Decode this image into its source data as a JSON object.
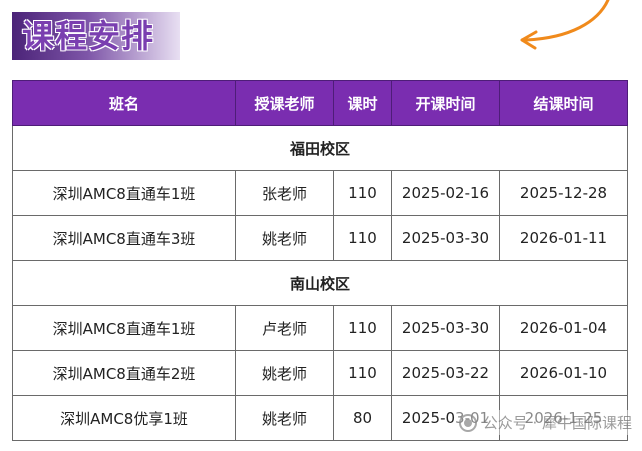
{
  "title": "课程安排",
  "table": {
    "headers": [
      "班名",
      "授课老师",
      "课时",
      "开课时间",
      "结课时间"
    ],
    "sections": [
      {
        "campus": "福田校区",
        "rows": [
          [
            "深圳AMC8直通车1班",
            "张老师",
            "110",
            "2025-02-16",
            "2025-12-28"
          ],
          [
            "深圳AMC8直通车3班",
            "姚老师",
            "110",
            "2025-03-30",
            "2026-01-11"
          ]
        ]
      },
      {
        "campus": "南山校区",
        "rows": [
          [
            "深圳AMC8直通车1班",
            "卢老师",
            "110",
            "2025-03-30",
            "2026-01-04"
          ],
          [
            "深圳AMC8直通车2班",
            "姚老师",
            "110",
            "2025-03-22",
            "2026-01-10"
          ],
          [
            "深圳AMC8优享1班",
            "姚老师",
            "80",
            "2025-03-01",
            "2026-1-25"
          ]
        ]
      }
    ]
  },
  "watermark": {
    "text": "公众号 · 犀牛国际课程",
    "icon": "wechat-icon"
  },
  "colors": {
    "header_bg": "#7a2db0",
    "title_text": "#7a3fb0",
    "arrow": "#f08a1c"
  }
}
